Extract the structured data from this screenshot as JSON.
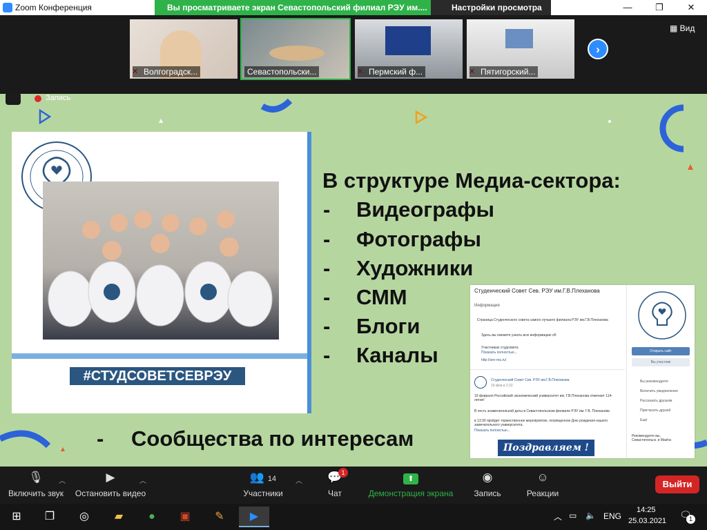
{
  "window": {
    "title": "Zoom Конференция"
  },
  "share_banner": "Вы просматриваете экран Севастопольский филиал РЭУ им....",
  "view_settings": "Настройки просмотра",
  "view_button": "Вид",
  "record_label": "Запись",
  "participants_strip": [
    {
      "name": "Волгоградск...",
      "muted": true
    },
    {
      "name": "Севастопольски...",
      "muted": false
    },
    {
      "name": "Пермский ф...",
      "muted": true
    },
    {
      "name": "Пятигорский...",
      "muted": true
    }
  ],
  "slide": {
    "heading": "В структуре Медиа-сектора:",
    "items": [
      "Видеографы",
      "Фотографы",
      "Художники",
      "СММ",
      "Блоги",
      "Каналы"
    ],
    "interest_item": "Сообщества по интересам",
    "hashtag": "#СТУДСОВЕТСЕВРЭУ",
    "logo_text": "СТУДЕНЧЕСКИЙ СОВЕТ СЕВРЭУ",
    "dash": "-",
    "vk": {
      "group_title": "Студенческий Совет Сев. РЭУ им.Г.В.Плеханова",
      "section": "Информация",
      "line1": "Страница Студенческого совета самого лучшего филиала РЭУ им.Г.В.Плеханова",
      "line2": "Здесь вы сможете узнать всю информацию об",
      "line3": "Участниках студсовета",
      "more": "Показать полностью...",
      "site": "http://sev-reu.ru/",
      "open_site_btn": "Открыть сайт",
      "member_btn": "Вы участник",
      "post_author": "Студенческий Совет Сев. РЭУ им.Г.В.Плеханова",
      "post_date": "19 фев в 2:22",
      "post_text1": "19 февраля Российский экономический университет им. Г.В.Плеханова отмечает 114-летие!",
      "post_text2": "В честь знаменательной даты в Севастопольском филиале РЭУ им. Г.В. Плеханова",
      "post_text3": "в 13:30 пройдет торжественное мероприятие, посвященное Дню рождения нашего замечательного университета.",
      "post_more": "Показать полностью...",
      "menu": [
        "Вы рекомендуете",
        "Включить уведомления",
        "Рассказать друзьям",
        "Пригласить друзей",
        "Ещё"
      ],
      "recommend": "Рекомендуете вы, Севастопольск. и Masha",
      "greeting": "Поздравляем !"
    }
  },
  "toolbar": {
    "mute": "Включить звук",
    "video": "Остановить видео",
    "participants": "Участники",
    "participants_count": "14",
    "chat": "Чат",
    "chat_badge": "1",
    "share": "Демонстрация экрана",
    "record": "Запись",
    "reactions": "Реакции",
    "leave": "Выйти"
  },
  "taskbar": {
    "lang": "ENG",
    "time": "14:25",
    "date": "25.03.2021",
    "notif_count": "1"
  },
  "colors": {
    "zoom_blue": "#2d8cff",
    "share_green": "#2fb24a",
    "leave_red": "#d42525",
    "slide_bg": "#b6d6a0"
  }
}
